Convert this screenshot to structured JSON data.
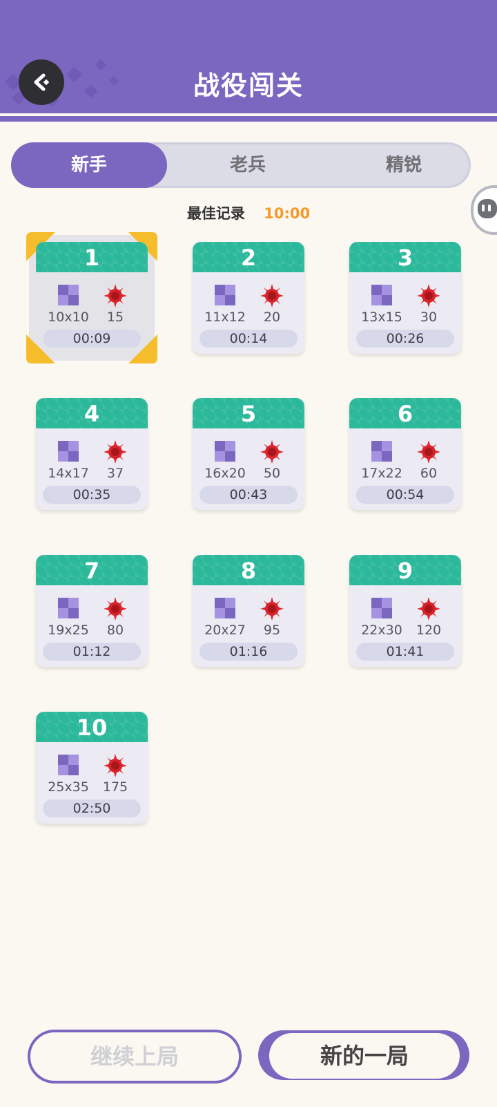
{
  "header": {
    "title": "战役闯关"
  },
  "tabs": [
    {
      "label": "新手",
      "active": true
    },
    {
      "label": "老兵",
      "active": false
    },
    {
      "label": "精锐",
      "active": false
    }
  ],
  "best": {
    "label": "最佳记录",
    "value": "10:00"
  },
  "levels": [
    {
      "num": "1",
      "size": "10x10",
      "mines": "15",
      "time": "00:09",
      "selected": true
    },
    {
      "num": "2",
      "size": "11x12",
      "mines": "20",
      "time": "00:14"
    },
    {
      "num": "3",
      "size": "13x15",
      "mines": "30",
      "time": "00:26"
    },
    {
      "num": "4",
      "size": "14x17",
      "mines": "37",
      "time": "00:35"
    },
    {
      "num": "5",
      "size": "16x20",
      "mines": "50",
      "time": "00:43"
    },
    {
      "num": "6",
      "size": "17x22",
      "mines": "60",
      "time": "00:54"
    },
    {
      "num": "7",
      "size": "19x25",
      "mines": "80",
      "time": "01:12"
    },
    {
      "num": "8",
      "size": "20x27",
      "mines": "95",
      "time": "01:16"
    },
    {
      "num": "9",
      "size": "22x30",
      "mines": "120",
      "time": "01:41"
    },
    {
      "num": "10",
      "size": "25x35",
      "mines": "175",
      "time": "02:50"
    }
  ],
  "buttons": {
    "continue": "继续上局",
    "new_game": "新的一局"
  },
  "colors": {
    "primary": "#7b66c0",
    "card_head": "#2cb89a",
    "best_value": "#f39a2b"
  }
}
